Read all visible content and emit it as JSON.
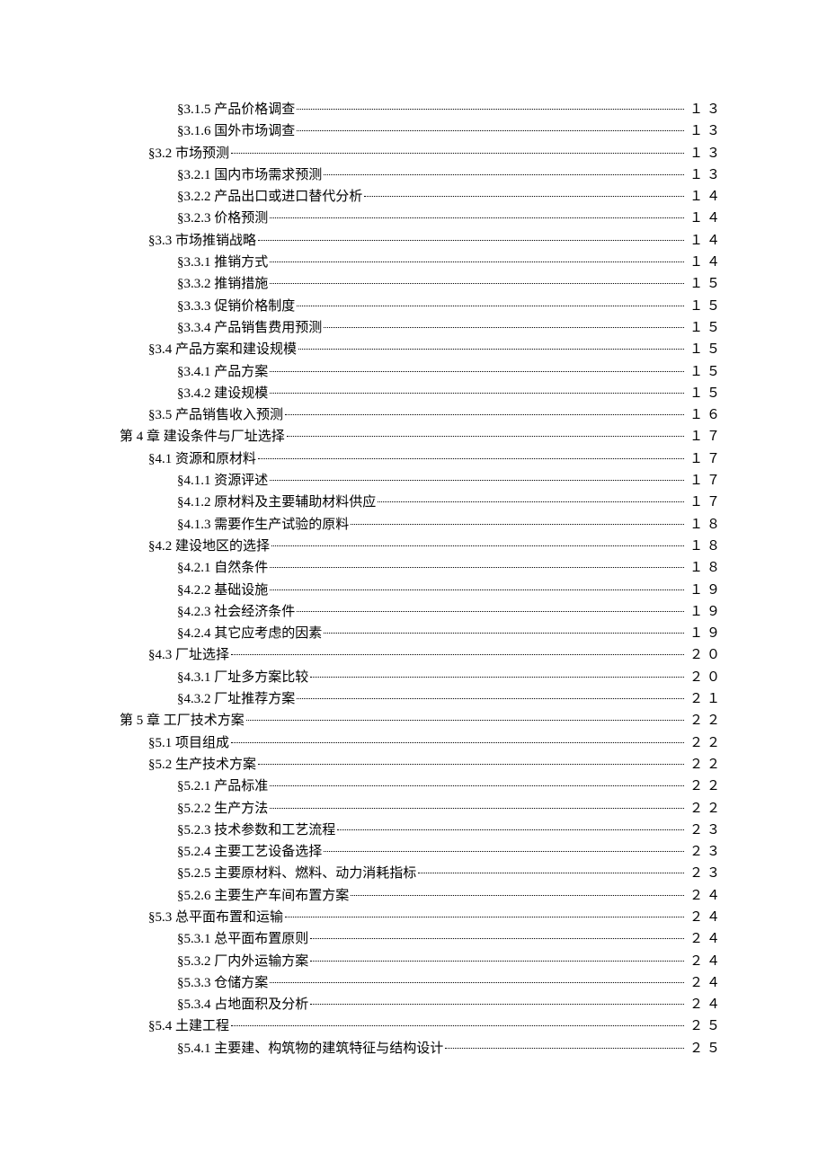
{
  "toc": [
    {
      "indent": 2,
      "label": "§3.1.5  产品价格调查",
      "page": "１３"
    },
    {
      "indent": 2,
      "label": "§3.1.6  国外市场调查",
      "page": "１３"
    },
    {
      "indent": 1,
      "label": "§3.2  市场预测",
      "page": "１３"
    },
    {
      "indent": 2,
      "label": "§3.2.1  国内市场需求预测",
      "page": "１３"
    },
    {
      "indent": 2,
      "label": "§3.2.2  产品出口或进口替代分析",
      "page": "１４"
    },
    {
      "indent": 2,
      "label": "§3.2.3  价格预测",
      "page": "１４"
    },
    {
      "indent": 1,
      "label": "§3.3  市场推销战略",
      "page": "１４"
    },
    {
      "indent": 2,
      "label": "§3.3.1  推销方式",
      "page": "１４"
    },
    {
      "indent": 2,
      "label": "§3.3.2  推销措施",
      "page": "１５"
    },
    {
      "indent": 2,
      "label": "§3.3.3  促销价格制度",
      "page": "１５"
    },
    {
      "indent": 2,
      "label": "§3.3.4  产品销售费用预测",
      "page": "１５"
    },
    {
      "indent": 1,
      "label": "§3.4  产品方案和建设规模",
      "page": "１５"
    },
    {
      "indent": 2,
      "label": "§3.4.1  产品方案",
      "page": "１５"
    },
    {
      "indent": 2,
      "label": "§3.4.2  建设规模",
      "page": "１５"
    },
    {
      "indent": 1,
      "label": "§3.5  产品销售收入预测",
      "page": "１６"
    },
    {
      "indent": 0,
      "label": "第 4 章  建设条件与厂址选择",
      "page": "１７"
    },
    {
      "indent": 1,
      "label": "§4.1  资源和原材料",
      "page": "１７"
    },
    {
      "indent": 2,
      "label": "§4.1.1  资源评述",
      "page": "１７"
    },
    {
      "indent": 2,
      "label": "§4.1.2  原材料及主要辅助材料供应",
      "page": "１７"
    },
    {
      "indent": 2,
      "label": "§4.1.3  需要作生产试验的原料",
      "page": "１８"
    },
    {
      "indent": 1,
      "label": "§4.2  建设地区的选择",
      "page": "１８"
    },
    {
      "indent": 2,
      "label": "§4.2.1  自然条件",
      "page": "１８"
    },
    {
      "indent": 2,
      "label": "§4.2.2  基础设施",
      "page": "１９"
    },
    {
      "indent": 2,
      "label": "§4.2.3  社会经济条件",
      "page": "１９"
    },
    {
      "indent": 2,
      "label": "§4.2.4  其它应考虑的因素",
      "page": "１９"
    },
    {
      "indent": 1,
      "label": "§4.3  厂址选择",
      "page": "２０"
    },
    {
      "indent": 2,
      "label": "§4.3.1  厂址多方案比较",
      "page": "２０"
    },
    {
      "indent": 2,
      "label": "§4.3.2  厂址推荐方案",
      "page": "２１"
    },
    {
      "indent": 0,
      "label": "第 5 章  工厂技术方案",
      "page": "２２"
    },
    {
      "indent": 1,
      "label": "§5.1  项目组成",
      "page": "２２"
    },
    {
      "indent": 1,
      "label": "§5.2  生产技术方案",
      "page": "２２"
    },
    {
      "indent": 2,
      "label": "§5.2.1  产品标准",
      "page": "２２"
    },
    {
      "indent": 2,
      "label": "§5.2.2  生产方法",
      "page": "２２"
    },
    {
      "indent": 2,
      "label": "§5.2.3  技术参数和工艺流程",
      "page": "２３"
    },
    {
      "indent": 2,
      "label": "§5.2.4  主要工艺设备选择",
      "page": "２３"
    },
    {
      "indent": 2,
      "label": "§5.2.5  主要原材料、燃料、动力消耗指标",
      "page": "２３"
    },
    {
      "indent": 2,
      "label": "§5.2.6  主要生产车间布置方案",
      "page": "２４"
    },
    {
      "indent": 1,
      "label": "§5.3  总平面布置和运输",
      "page": "２４"
    },
    {
      "indent": 2,
      "label": "§5.3.1  总平面布置原则",
      "page": "２４"
    },
    {
      "indent": 2,
      "label": "§5.3.2  厂内外运输方案",
      "page": "２４"
    },
    {
      "indent": 2,
      "label": "§5.3.3  仓储方案",
      "page": "２４"
    },
    {
      "indent": 2,
      "label": "§5.3.4  占地面积及分析",
      "page": "２４"
    },
    {
      "indent": 1,
      "label": "§5.4  土建工程",
      "page": "２５"
    },
    {
      "indent": 2,
      "label": "§5.4.1  主要建、构筑物的建筑特征与结构设计",
      "page": "２５"
    }
  ]
}
